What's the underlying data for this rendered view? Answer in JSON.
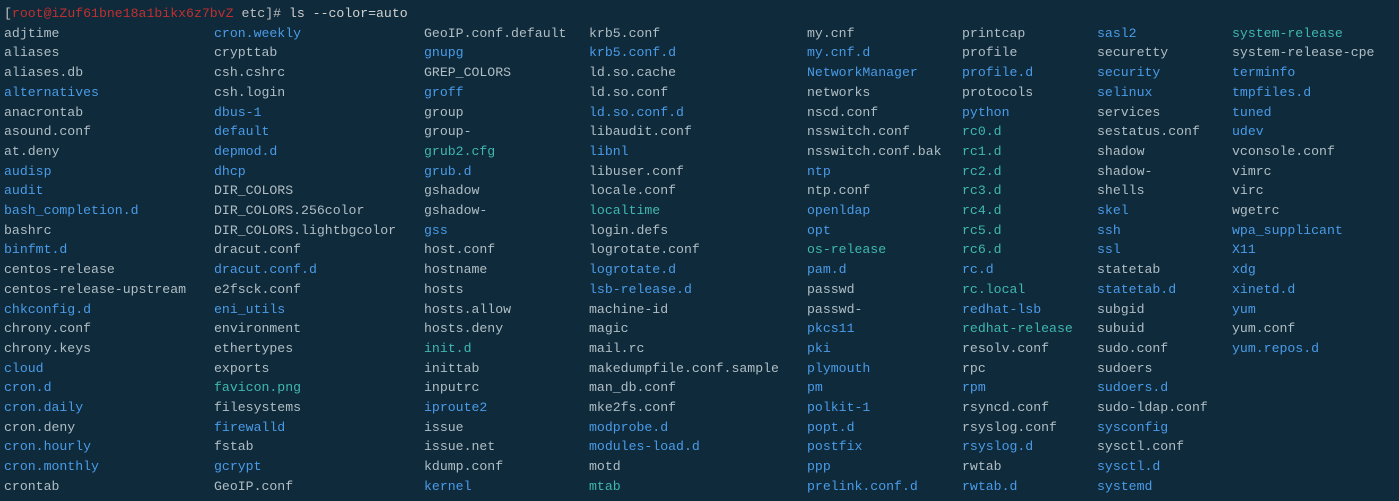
{
  "prompt": {
    "user_host": "root@iZuf61bne18a1bikx6z7bvZ",
    "cwd": "etc",
    "command": "ls --color=auto"
  },
  "columns": [
    [
      {
        "name": "adjtime",
        "type": "file"
      },
      {
        "name": "aliases",
        "type": "file"
      },
      {
        "name": "aliases.db",
        "type": "file"
      },
      {
        "name": "alternatives",
        "type": "dir"
      },
      {
        "name": "anacrontab",
        "type": "file"
      },
      {
        "name": "asound.conf",
        "type": "file"
      },
      {
        "name": "at.deny",
        "type": "file"
      },
      {
        "name": "audisp",
        "type": "dir"
      },
      {
        "name": "audit",
        "type": "dir"
      },
      {
        "name": "bash_completion.d",
        "type": "dir"
      },
      {
        "name": "bashrc",
        "type": "file"
      },
      {
        "name": "binfmt.d",
        "type": "dir"
      },
      {
        "name": "centos-release",
        "type": "file"
      },
      {
        "name": "centos-release-upstream",
        "type": "file"
      },
      {
        "name": "chkconfig.d",
        "type": "dir"
      },
      {
        "name": "chrony.conf",
        "type": "file"
      },
      {
        "name": "chrony.keys",
        "type": "file"
      },
      {
        "name": "cloud",
        "type": "dir"
      },
      {
        "name": "cron.d",
        "type": "dir"
      },
      {
        "name": "cron.daily",
        "type": "dir"
      },
      {
        "name": "cron.deny",
        "type": "file"
      },
      {
        "name": "cron.hourly",
        "type": "dir"
      },
      {
        "name": "cron.monthly",
        "type": "dir"
      },
      {
        "name": "crontab",
        "type": "file"
      }
    ],
    [
      {
        "name": "cron.weekly",
        "type": "dir"
      },
      {
        "name": "crypttab",
        "type": "file"
      },
      {
        "name": "csh.cshrc",
        "type": "file"
      },
      {
        "name": "csh.login",
        "type": "file"
      },
      {
        "name": "dbus-1",
        "type": "dir"
      },
      {
        "name": "default",
        "type": "dir"
      },
      {
        "name": "depmod.d",
        "type": "dir"
      },
      {
        "name": "dhcp",
        "type": "dir"
      },
      {
        "name": "DIR_COLORS",
        "type": "file"
      },
      {
        "name": "DIR_COLORS.256color",
        "type": "file"
      },
      {
        "name": "DIR_COLORS.lightbgcolor",
        "type": "file"
      },
      {
        "name": "dracut.conf",
        "type": "file"
      },
      {
        "name": "dracut.conf.d",
        "type": "dir"
      },
      {
        "name": "e2fsck.conf",
        "type": "file"
      },
      {
        "name": "eni_utils",
        "type": "dir"
      },
      {
        "name": "environment",
        "type": "file"
      },
      {
        "name": "ethertypes",
        "type": "file"
      },
      {
        "name": "exports",
        "type": "file"
      },
      {
        "name": "favicon.png",
        "type": "link"
      },
      {
        "name": "filesystems",
        "type": "file"
      },
      {
        "name": "firewalld",
        "type": "dir"
      },
      {
        "name": "fstab",
        "type": "file"
      },
      {
        "name": "gcrypt",
        "type": "dir"
      },
      {
        "name": "GeoIP.conf",
        "type": "file"
      }
    ],
    [
      {
        "name": "GeoIP.conf.default",
        "type": "file"
      },
      {
        "name": "gnupg",
        "type": "dir"
      },
      {
        "name": "GREP_COLORS",
        "type": "file"
      },
      {
        "name": "groff",
        "type": "dir"
      },
      {
        "name": "group",
        "type": "file"
      },
      {
        "name": "group-",
        "type": "file"
      },
      {
        "name": "grub2.cfg",
        "type": "link"
      },
      {
        "name": "grub.d",
        "type": "dir"
      },
      {
        "name": "gshadow",
        "type": "file"
      },
      {
        "name": "gshadow-",
        "type": "file"
      },
      {
        "name": "gss",
        "type": "dir"
      },
      {
        "name": "host.conf",
        "type": "file"
      },
      {
        "name": "hostname",
        "type": "file"
      },
      {
        "name": "hosts",
        "type": "file"
      },
      {
        "name": "hosts.allow",
        "type": "file"
      },
      {
        "name": "hosts.deny",
        "type": "file"
      },
      {
        "name": "init.d",
        "type": "link"
      },
      {
        "name": "inittab",
        "type": "file"
      },
      {
        "name": "inputrc",
        "type": "file"
      },
      {
        "name": "iproute2",
        "type": "dir"
      },
      {
        "name": "issue",
        "type": "file"
      },
      {
        "name": "issue.net",
        "type": "file"
      },
      {
        "name": "kdump.conf",
        "type": "file"
      },
      {
        "name": "kernel",
        "type": "dir"
      }
    ],
    [
      {
        "name": "krb5.conf",
        "type": "file"
      },
      {
        "name": "krb5.conf.d",
        "type": "dir"
      },
      {
        "name": "ld.so.cache",
        "type": "file"
      },
      {
        "name": "ld.so.conf",
        "type": "file"
      },
      {
        "name": "ld.so.conf.d",
        "type": "dir"
      },
      {
        "name": "libaudit.conf",
        "type": "file"
      },
      {
        "name": "libnl",
        "type": "dir"
      },
      {
        "name": "libuser.conf",
        "type": "file"
      },
      {
        "name": "locale.conf",
        "type": "file"
      },
      {
        "name": "localtime",
        "type": "link"
      },
      {
        "name": "login.defs",
        "type": "file"
      },
      {
        "name": "logrotate.conf",
        "type": "file"
      },
      {
        "name": "logrotate.d",
        "type": "dir"
      },
      {
        "name": "lsb-release.d",
        "type": "dir"
      },
      {
        "name": "machine-id",
        "type": "file"
      },
      {
        "name": "magic",
        "type": "file"
      },
      {
        "name": "mail.rc",
        "type": "file"
      },
      {
        "name": "makedumpfile.conf.sample",
        "type": "file"
      },
      {
        "name": "man_db.conf",
        "type": "file"
      },
      {
        "name": "mke2fs.conf",
        "type": "file"
      },
      {
        "name": "modprobe.d",
        "type": "dir"
      },
      {
        "name": "modules-load.d",
        "type": "dir"
      },
      {
        "name": "motd",
        "type": "file"
      },
      {
        "name": "mtab",
        "type": "link"
      }
    ],
    [
      {
        "name": "my.cnf",
        "type": "file"
      },
      {
        "name": "my.cnf.d",
        "type": "dir"
      },
      {
        "name": "NetworkManager",
        "type": "dir"
      },
      {
        "name": "networks",
        "type": "file"
      },
      {
        "name": "nscd.conf",
        "type": "file"
      },
      {
        "name": "nsswitch.conf",
        "type": "file"
      },
      {
        "name": "nsswitch.conf.bak",
        "type": "file"
      },
      {
        "name": "ntp",
        "type": "dir"
      },
      {
        "name": "ntp.conf",
        "type": "file"
      },
      {
        "name": "openldap",
        "type": "dir"
      },
      {
        "name": "opt",
        "type": "dir"
      },
      {
        "name": "os-release",
        "type": "link"
      },
      {
        "name": "pam.d",
        "type": "dir"
      },
      {
        "name": "passwd",
        "type": "file"
      },
      {
        "name": "passwd-",
        "type": "file"
      },
      {
        "name": "pkcs11",
        "type": "dir"
      },
      {
        "name": "pki",
        "type": "dir"
      },
      {
        "name": "plymouth",
        "type": "dir"
      },
      {
        "name": "pm",
        "type": "dir"
      },
      {
        "name": "polkit-1",
        "type": "dir"
      },
      {
        "name": "popt.d",
        "type": "dir"
      },
      {
        "name": "postfix",
        "type": "dir"
      },
      {
        "name": "ppp",
        "type": "dir"
      },
      {
        "name": "prelink.conf.d",
        "type": "dir"
      }
    ],
    [
      {
        "name": "printcap",
        "type": "file"
      },
      {
        "name": "profile",
        "type": "file"
      },
      {
        "name": "profile.d",
        "type": "dir"
      },
      {
        "name": "protocols",
        "type": "file"
      },
      {
        "name": "python",
        "type": "dir"
      },
      {
        "name": "rc0.d",
        "type": "link"
      },
      {
        "name": "rc1.d",
        "type": "link"
      },
      {
        "name": "rc2.d",
        "type": "link"
      },
      {
        "name": "rc3.d",
        "type": "link"
      },
      {
        "name": "rc4.d",
        "type": "link"
      },
      {
        "name": "rc5.d",
        "type": "link"
      },
      {
        "name": "rc6.d",
        "type": "link"
      },
      {
        "name": "rc.d",
        "type": "dir"
      },
      {
        "name": "rc.local",
        "type": "link"
      },
      {
        "name": "redhat-lsb",
        "type": "dir"
      },
      {
        "name": "redhat-release",
        "type": "link"
      },
      {
        "name": "resolv.conf",
        "type": "file"
      },
      {
        "name": "rpc",
        "type": "file"
      },
      {
        "name": "rpm",
        "type": "dir"
      },
      {
        "name": "rsyncd.conf",
        "type": "file"
      },
      {
        "name": "rsyslog.conf",
        "type": "file"
      },
      {
        "name": "rsyslog.d",
        "type": "dir"
      },
      {
        "name": "rwtab",
        "type": "file"
      },
      {
        "name": "rwtab.d",
        "type": "dir"
      }
    ],
    [
      {
        "name": "sasl2",
        "type": "dir"
      },
      {
        "name": "securetty",
        "type": "file"
      },
      {
        "name": "security",
        "type": "dir"
      },
      {
        "name": "selinux",
        "type": "dir"
      },
      {
        "name": "services",
        "type": "file"
      },
      {
        "name": "sestatus.conf",
        "type": "file"
      },
      {
        "name": "shadow",
        "type": "file"
      },
      {
        "name": "shadow-",
        "type": "file"
      },
      {
        "name": "shells",
        "type": "file"
      },
      {
        "name": "skel",
        "type": "dir"
      },
      {
        "name": "ssh",
        "type": "dir"
      },
      {
        "name": "ssl",
        "type": "dir"
      },
      {
        "name": "statetab",
        "type": "file"
      },
      {
        "name": "statetab.d",
        "type": "dir"
      },
      {
        "name": "subgid",
        "type": "file"
      },
      {
        "name": "subuid",
        "type": "file"
      },
      {
        "name": "sudo.conf",
        "type": "file"
      },
      {
        "name": "sudoers",
        "type": "file"
      },
      {
        "name": "sudoers.d",
        "type": "dir"
      },
      {
        "name": "sudo-ldap.conf",
        "type": "file"
      },
      {
        "name": "sysconfig",
        "type": "dir"
      },
      {
        "name": "sysctl.conf",
        "type": "file"
      },
      {
        "name": "sysctl.d",
        "type": "dir"
      },
      {
        "name": "systemd",
        "type": "dir"
      }
    ],
    [
      {
        "name": "system-release",
        "type": "link"
      },
      {
        "name": "system-release-cpe",
        "type": "file"
      },
      {
        "name": "terminfo",
        "type": "dir"
      },
      {
        "name": "tmpfiles.d",
        "type": "dir"
      },
      {
        "name": "tuned",
        "type": "dir"
      },
      {
        "name": "udev",
        "type": "dir"
      },
      {
        "name": "vconsole.conf",
        "type": "file"
      },
      {
        "name": "vimrc",
        "type": "file"
      },
      {
        "name": "virc",
        "type": "file"
      },
      {
        "name": "wgetrc",
        "type": "file"
      },
      {
        "name": "wpa_supplicant",
        "type": "dir"
      },
      {
        "name": "X11",
        "type": "dir"
      },
      {
        "name": "xdg",
        "type": "dir"
      },
      {
        "name": "xinetd.d",
        "type": "dir"
      },
      {
        "name": "yum",
        "type": "dir"
      },
      {
        "name": "yum.conf",
        "type": "file"
      },
      {
        "name": "yum.repos.d",
        "type": "dir"
      }
    ]
  ]
}
